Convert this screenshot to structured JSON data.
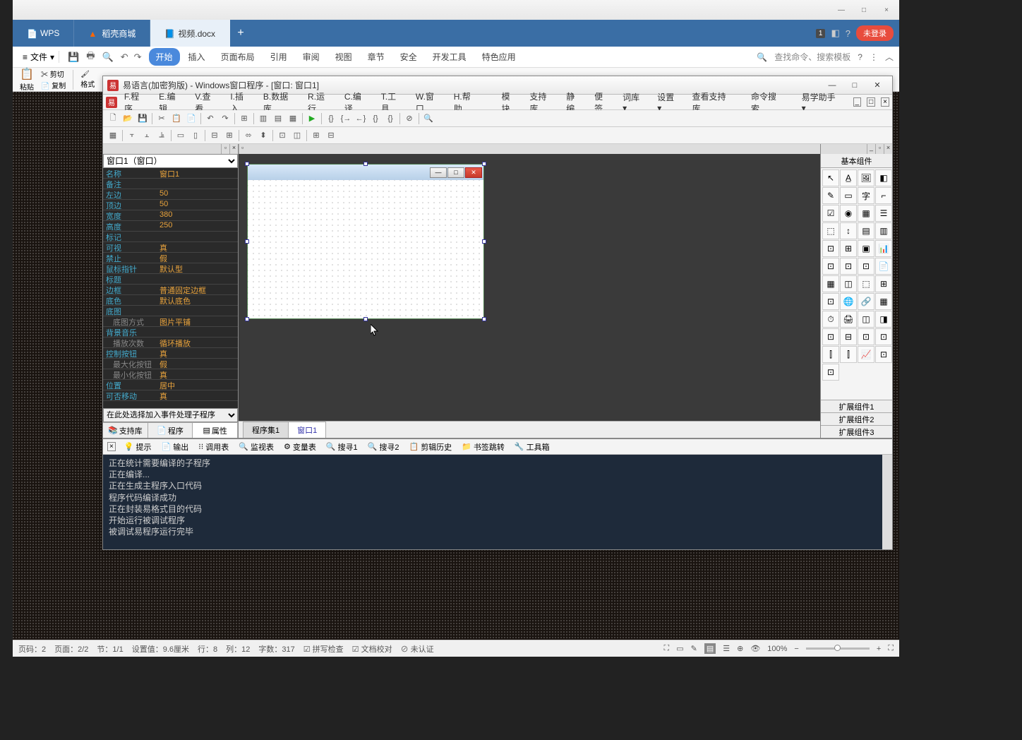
{
  "wps": {
    "titlebar": {
      "min": "—",
      "max": "□",
      "close": "×"
    },
    "tabs": {
      "wps": "WPS",
      "docer": "稻壳商城",
      "doc": "视频.docx",
      "new": "+"
    },
    "tabright": {
      "badge": "1",
      "login": "未登录"
    },
    "ribbon_file": "文件",
    "ribbons": [
      "开始",
      "插入",
      "页面布局",
      "引用",
      "审阅",
      "视图",
      "章节",
      "安全",
      "开发工具",
      "特色应用"
    ],
    "ribbon_right": {
      "search": "查找命令、搜索模板"
    },
    "toolbar_left": {
      "paste": "粘贴",
      "cut": "剪切",
      "copy": "复制",
      "format": "格式"
    },
    "status": {
      "page_label": "页码：",
      "page_val": "2",
      "pages_label": "页面：",
      "pages_val": "2/2",
      "section_label": "节：",
      "section_val": "1/1",
      "pos_label": "设置值：",
      "pos_val": "9.6厘米",
      "row_label": "行：",
      "row_val": "8",
      "col_label": "列：",
      "col_val": "12",
      "words_label": "字数：",
      "words_val": "317",
      "spell": "拼写检查",
      "proof": "文档校对",
      "cert": "未认证",
      "zoom": "100%"
    }
  },
  "ide": {
    "title": "易语言(加密狗版) - Windows窗口程序 - [窗口: 窗口1]",
    "menus": [
      "F.程序",
      "E.编辑",
      "V.查看",
      "I.插入",
      "B.数据库",
      "R.运行",
      "C.编译",
      "T.工具",
      "W.窗口",
      "H.帮助"
    ],
    "menus2": [
      "模块",
      "支持库",
      "静编",
      "便签",
      "词库 ▾",
      "设置 ▾"
    ],
    "menus_right": [
      "查看支持库",
      "命令搜索"
    ],
    "helper": "易学助手 ▾",
    "prop_select": "窗口1（窗口）",
    "props": [
      {
        "l": "名称",
        "v": "窗口1"
      },
      {
        "l": "备注",
        "v": ""
      },
      {
        "l": "左边",
        "v": "50"
      },
      {
        "l": "顶边",
        "v": "50"
      },
      {
        "l": "宽度",
        "v": "380"
      },
      {
        "l": "高度",
        "v": "250"
      },
      {
        "l": "标记",
        "v": ""
      },
      {
        "l": "可视",
        "v": "真"
      },
      {
        "l": "禁止",
        "v": "假"
      },
      {
        "l": "鼠标指针",
        "v": "默认型"
      },
      {
        "l": "标题",
        "v": ""
      },
      {
        "l": "边框",
        "v": "普通固定边框"
      },
      {
        "l": "底色",
        "v": "默认底色"
      },
      {
        "l": "底图",
        "v": ""
      },
      {
        "l": "底图方式",
        "v": "图片平铺",
        "indent": true
      },
      {
        "l": "背景音乐",
        "v": ""
      },
      {
        "l": "播放次数",
        "v": "循环播放",
        "indent": true
      },
      {
        "l": "控制按钮",
        "v": "真"
      },
      {
        "l": "最大化按钮",
        "v": "假",
        "indent": true
      },
      {
        "l": "最小化按钮",
        "v": "真",
        "indent": true
      },
      {
        "l": "位置",
        "v": "居中"
      },
      {
        "l": "可否移动",
        "v": "真"
      }
    ],
    "event_select": "在此处选择加入事件处理子程序",
    "left_tabs": [
      "支持库",
      "程序",
      "属性"
    ],
    "center_tabs": [
      "程序集1",
      "窗口1"
    ],
    "comp_title": "基本组件",
    "ext_tabs": [
      "扩展组件1",
      "扩展组件2",
      "扩展组件3"
    ],
    "output_tabs": [
      "提示",
      "输出",
      "调用表",
      "监视表",
      "变量表",
      "搜寻1",
      "搜寻2",
      "剪辑历史",
      "书签跳转",
      "工具箱"
    ],
    "output_lines": [
      "正在统计需要编译的子程序",
      "正在编译...",
      "正在生成主程序入口代码",
      "程序代码编译成功",
      "正在封装易格式目的代码",
      "开始运行被调试程序",
      "被调试易程序运行完毕"
    ]
  }
}
